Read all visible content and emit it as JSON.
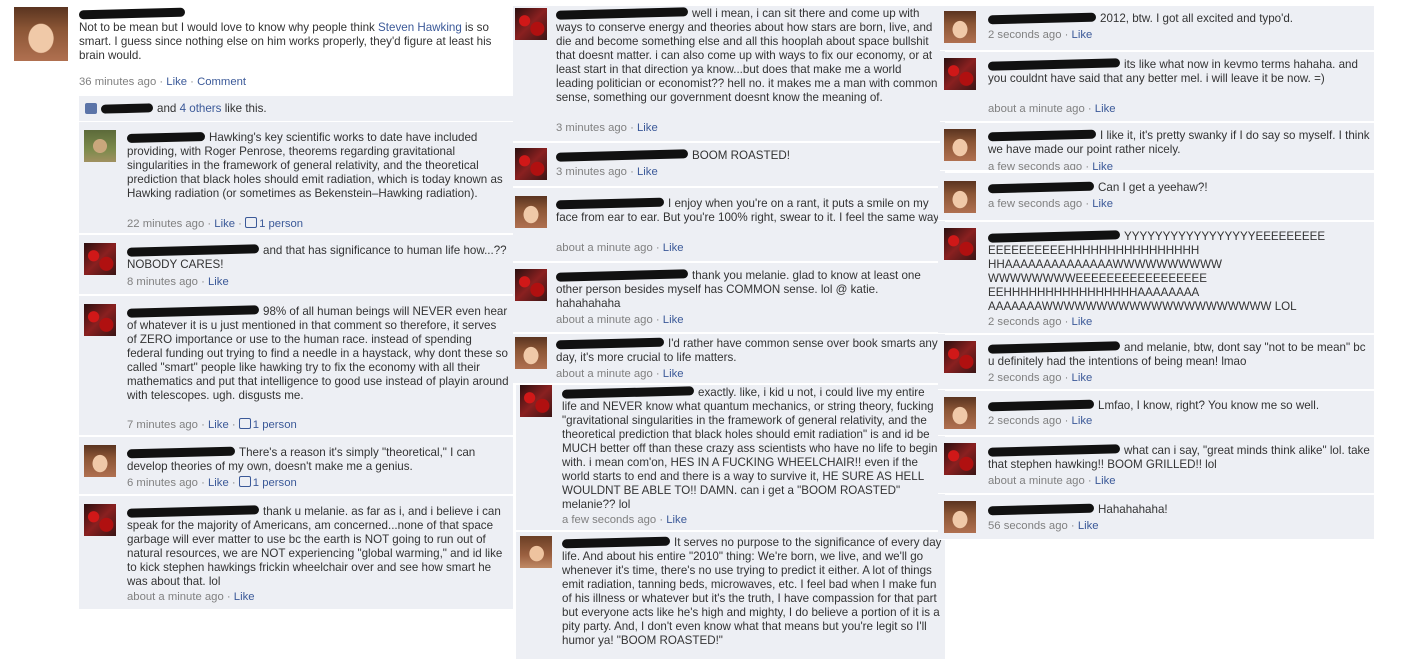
{
  "post": {
    "text_pre": "Not to be mean but I would love to know why people think ",
    "link": "Steven Hawking",
    "text_post": " is so smart. I guess since nothing else on him works properly, they'd figure at least his brain would.",
    "time": "36 minutes ago",
    "like": "Like",
    "comment": "Comment",
    "likes_and": "and",
    "likes_others": "4 others",
    "likes_suffix": "like this."
  },
  "sep": " · ",
  "person": "1 person",
  "like": "Like",
  "col1": [
    {
      "text": "Hawking's key scientific works to date have included providing, with Roger Penrose, theorems regarding gravitational singularities in the framework of general relativity, and the theoretical prediction that black holes should emit radiation, which is today known as Hawking radiation (or sometimes as Bekenstein–Hawking radiation).",
      "time": "22 minutes ago",
      "person": true
    },
    {
      "text": "and that has significance to human life how...?? NOBODY CARES!",
      "time": "8 minutes ago",
      "person": false
    },
    {
      "text": "98% of all human beings will NEVER even hear of whatever it is u just mentioned in that comment so therefore, it serves of ZERO importance or use to the human race. instead of spending federal funding out trying to find a needle in a haystack, why dont these so called \"smart\" people like hawking try to fix the economy with all their mathematics and put that intelligence to good use instead of playin around with telescopes. ugh. disgusts me.",
      "time": "7 minutes ago",
      "person": true
    },
    {
      "text": "There's a reason it's simply \"theoretical,\" I can develop theories of my own, doesn't make me a genius.",
      "time": "6 minutes ago",
      "person": true
    },
    {
      "text": "thank u melanie. as far as i, and i believe i can speak for the majority of Americans, am concerned...none of that space garbage will ever matter to use bc the earth is NOT going to run out of natural resources, we are NOT experiencing \"global warming,\" and id like to kick stephen hawkings frickin wheelchair over and see how smart he was about that. lol",
      "time": "about a minute ago",
      "person": false
    }
  ],
  "col2": [
    {
      "text": "well i mean, i can sit there and come up with ways to conserve energy and theories about how stars are born, live, and die and become something else and all this hooplah about space bullshit that doesnt matter. i can also come up with ways to fix our economy, or at least start in that direction ya know...but does that make me a world leading politician or economist?? hell no. it makes me a man with common sense, something our government doesnt know the meaning of.",
      "time": "3 minutes ago"
    },
    {
      "text": "BOOM ROASTED!",
      "time": "3 minutes ago"
    },
    {
      "text": "I enjoy when you're on a rant, it puts a smile on my face from ear to ear. But you're 100% right, swear to it. I feel the same way.",
      "time": "about a minute ago"
    },
    {
      "text": "thank you melanie. glad to know at least one other person besides myself has COMMON sense. lol @ katie. hahahahaha",
      "time": "about a minute ago"
    },
    {
      "text": "I'd rather have common sense over book smarts any day, it's more crucial to life matters.",
      "time": "about a minute ago"
    },
    {
      "text": "exactly. like, i kid u not, i could live my entire life and NEVER know what quantum mechanics, or string theory, fucking \"gravitational singularities in the framework of general relativity, and the theoretical prediction that black holes should emit radiation\" is and id be MUCH better off than these crazy ass scientists who have no life to begin with. i mean com'on, HES IN A FUCKING WHEELCHAIR!! even if the world starts to end and there is a way to survive it, HE SURE AS HELL WOULDNT BE ABLE TO!! DAMN. can i get a \"BOOM ROASTED\" melanie?? lol",
      "time": "a few seconds ago"
    },
    {
      "text": "It serves no purpose to the significance of every day life. And about his entire \"2010\" thing: We're born, we live, and we'll go whenever it's time, there's no use trying to predict it either. A lot of things emit radiation, tanning beds, microwaves, etc. I feel bad when I make fun of his illness or whatever but it's the truth, I have compassion for that part but everyone acts like he's high and mighty, I do believe a portion of it is a pity party. And, I don't even know what that means but you're legit so I'll humor ya! \"BOOM ROASTED!\"",
      "time": ""
    }
  ],
  "col3": [
    {
      "text": "2012, btw. I got all excited and typo'd.",
      "time": "2 seconds ago"
    },
    {
      "text": "its like what now in kevmo terms hahaha. and you couldnt have said that any better mel. i will leave it be now. =)",
      "time": "about a minute ago"
    },
    {
      "text": "I like it, it's pretty swanky if I do say so myself. I think we have made our point rather nicely.",
      "time": "a few seconds ago"
    },
    {
      "text": "Can I get a yeehaw?!",
      "time": "a few seconds ago"
    },
    {
      "text": "YYYYYYYYYYYYYYYYYEEEEEEEEE EEEEEEEEEEHHHHHHHHHHHHHHHH HHAAAAAAAAAAAAAAWWWWWWWWWW WWWWWWWWEEEEEEEEEEEEEEEEE EEHHHHHHHHHHHHHHHHAAAAAAAA AAAAAAAWWWWWWWWWWWWWWWWWWWWW LOL",
      "time": "2 seconds ago"
    },
    {
      "text": "and melanie, btw, dont say \"not to be mean\" bc u definitely had the intentions of being mean! lmao",
      "time": "2 seconds ago"
    },
    {
      "text": "Lmfao, I know, right? You know me so well.",
      "time": "2 seconds ago"
    },
    {
      "text": "what can i say, \"great minds think alike\" lol. take that stephen hawking!! BOOM GRILLED!! lol",
      "time": "about a minute ago"
    },
    {
      "text": "Hahahahaha!",
      "time": "56 seconds ago"
    }
  ]
}
